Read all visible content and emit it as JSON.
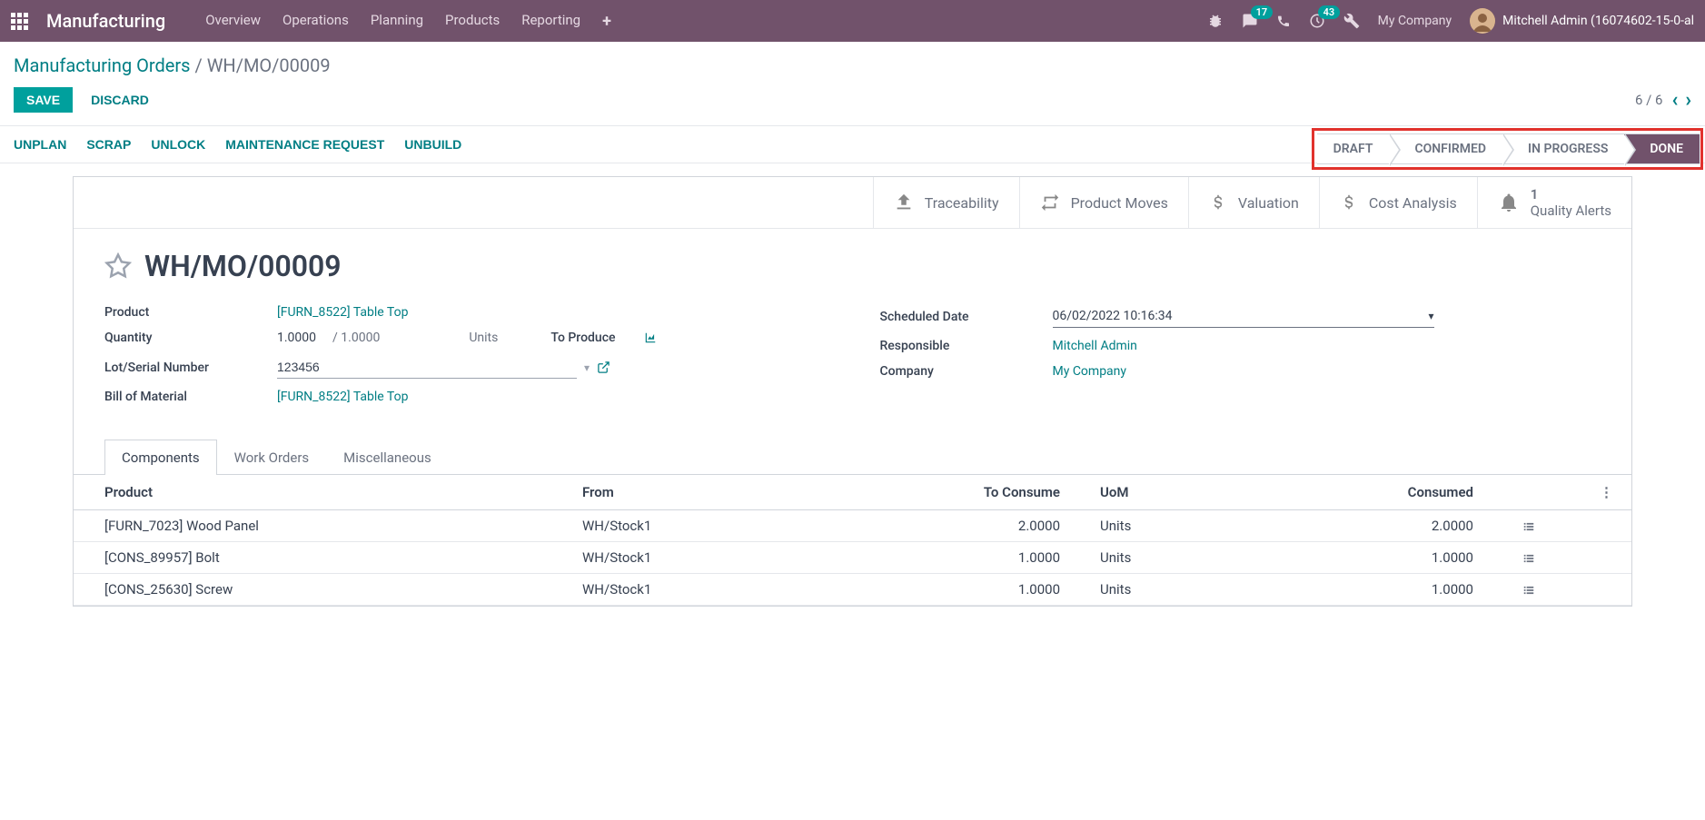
{
  "navbar": {
    "app_title": "Manufacturing",
    "menu": [
      "Overview",
      "Operations",
      "Planning",
      "Products",
      "Reporting"
    ],
    "msg_badge": "17",
    "activity_badge": "43",
    "company": "My Company",
    "user": "Mitchell Admin (16074602-15-0-al"
  },
  "breadcrumb": {
    "parent": "Manufacturing Orders",
    "current": "WH/MO/00009"
  },
  "control": {
    "save": "SAVE",
    "discard": "DISCARD",
    "pager": "6 / 6"
  },
  "actions": {
    "buttons": [
      "UNPLAN",
      "SCRAP",
      "UNLOCK",
      "MAINTENANCE REQUEST",
      "UNBUILD"
    ]
  },
  "status": {
    "steps": [
      "DRAFT",
      "CONFIRMED",
      "IN PROGRESS",
      "DONE"
    ],
    "active": "DONE"
  },
  "stat_buttons": {
    "traceability": "Traceability",
    "product_moves": "Product Moves",
    "valuation": "Valuation",
    "cost_analysis": "Cost Analysis",
    "quality_alerts_count": "1",
    "quality_alerts": "Quality Alerts"
  },
  "record": {
    "title": "WH/MO/00009",
    "fields": {
      "product_label": "Product",
      "product_value": "[FURN_8522] Table Top",
      "quantity_label": "Quantity",
      "quantity_value": "1.0000",
      "quantity_of": "/ 1.0000",
      "quantity_uom": "Units",
      "to_produce": "To Produce",
      "lot_label": "Lot/Serial Number",
      "lot_value": "123456",
      "bom_label": "Bill of Material",
      "bom_value": "[FURN_8522] Table Top",
      "scheduled_label": "Scheduled Date",
      "scheduled_value": "06/02/2022 10:16:34",
      "responsible_label": "Responsible",
      "responsible_value": "Mitchell Admin",
      "company_label": "Company",
      "company_value": "My Company"
    }
  },
  "tabs": [
    "Components",
    "Work Orders",
    "Miscellaneous"
  ],
  "components": {
    "headers": {
      "product": "Product",
      "from": "From",
      "to_consume": "To Consume",
      "uom": "UoM",
      "consumed": "Consumed"
    },
    "rows": [
      {
        "product": "[FURN_7023] Wood Panel",
        "from": "WH/Stock1",
        "to_consume": "2.0000",
        "uom": "Units",
        "consumed": "2.0000"
      },
      {
        "product": "[CONS_89957] Bolt",
        "from": "WH/Stock1",
        "to_consume": "1.0000",
        "uom": "Units",
        "consumed": "1.0000"
      },
      {
        "product": "[CONS_25630] Screw",
        "from": "WH/Stock1",
        "to_consume": "1.0000",
        "uom": "Units",
        "consumed": "1.0000"
      }
    ]
  }
}
